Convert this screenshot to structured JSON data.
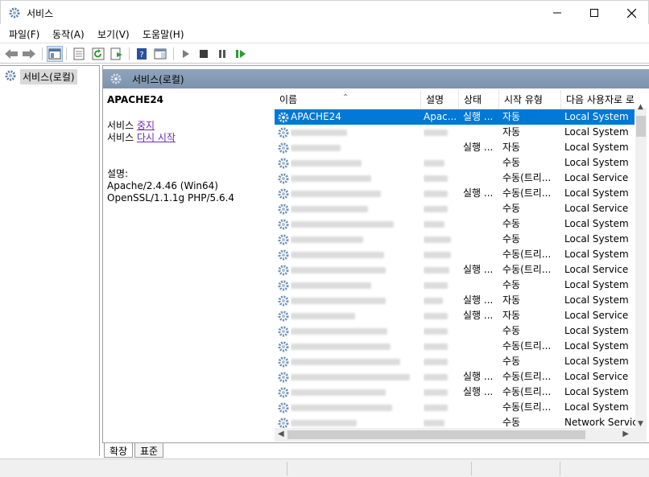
{
  "window": {
    "title": "서비스"
  },
  "menu": [
    "파일(F)",
    "동작(A)",
    "보기(V)",
    "도움말(H)"
  ],
  "tree": {
    "root_label": "서비스(로컬)"
  },
  "main": {
    "header_title": "서비스(로컬)"
  },
  "detail": {
    "service_name": "APACHE24",
    "stop_prefix": "서비스 ",
    "stop_link": "중지",
    "restart_prefix": "서비스 ",
    "restart_link": "다시 시작",
    "desc_label": "설명:",
    "desc_line1": "Apache/2.4.46 (Win64)",
    "desc_line2": "OpenSSL/1.1.1g PHP/5.6.4"
  },
  "columns": {
    "name": "이름",
    "desc": "설명",
    "status": "상태",
    "start": "시작 유형",
    "logon": "다음 사용자로 로"
  },
  "services": [
    {
      "name": "APACHE24",
      "desc": "Apac...",
      "status": "실행 ...",
      "start": "자동",
      "logon": "Local System",
      "selected": true
    },
    {
      "name": "",
      "desc": "",
      "status": "",
      "start": "자동",
      "logon": "Local System"
    },
    {
      "name": "",
      "desc": "",
      "status": "실행 ...",
      "start": "자동",
      "logon": "Local System"
    },
    {
      "name": "",
      "desc": "",
      "status": "",
      "start": "수동",
      "logon": "Local System"
    },
    {
      "name": "",
      "desc": "",
      "status": "",
      "start": "수동(트리...",
      "logon": "Local Service"
    },
    {
      "name": "",
      "desc": "",
      "status": "실행 ...",
      "start": "수동(트리...",
      "logon": "Local System"
    },
    {
      "name": "",
      "desc": "",
      "status": "",
      "start": "수동",
      "logon": "Local Service"
    },
    {
      "name": "",
      "desc": "",
      "status": "",
      "start": "수동",
      "logon": "Local System"
    },
    {
      "name": "",
      "desc": "",
      "status": "",
      "start": "수동",
      "logon": "Local System"
    },
    {
      "name": "",
      "desc": "",
      "status": "",
      "start": "수동(트리...",
      "logon": "Local System"
    },
    {
      "name": "",
      "desc": "",
      "status": "실행 ...",
      "start": "수동(트리...",
      "logon": "Local Service"
    },
    {
      "name": "",
      "desc": "",
      "status": "",
      "start": "수동",
      "logon": "Local System"
    },
    {
      "name": "",
      "desc": "",
      "status": "실행 ...",
      "start": "자동",
      "logon": "Local System"
    },
    {
      "name": "",
      "desc": "",
      "status": "실행 ...",
      "start": "자동",
      "logon": "Local Service"
    },
    {
      "name": "",
      "desc": "",
      "status": "",
      "start": "수동",
      "logon": "Local System"
    },
    {
      "name": "",
      "desc": "",
      "status": "",
      "start": "수동(트리...",
      "logon": "Local System"
    },
    {
      "name": "",
      "desc": "",
      "status": "",
      "start": "수동",
      "logon": "Local System"
    },
    {
      "name": "",
      "desc": "",
      "status": "실행 ...",
      "start": "수동(트리...",
      "logon": "Local Service"
    },
    {
      "name": "",
      "desc": "",
      "status": "실행 ...",
      "start": "수동(트리...",
      "logon": "Local System"
    },
    {
      "name": "",
      "desc": "",
      "status": "",
      "start": "수동(트리...",
      "logon": "Local System"
    },
    {
      "name": "",
      "desc": "",
      "status": "",
      "start": "수동",
      "logon": "Network Service"
    }
  ],
  "tabs": {
    "extended": "확장",
    "standard": "표준"
  },
  "colors": {
    "selected_row": "#0078d7",
    "header_band": "#8fa3bc",
    "link": "#6b2bb5"
  }
}
